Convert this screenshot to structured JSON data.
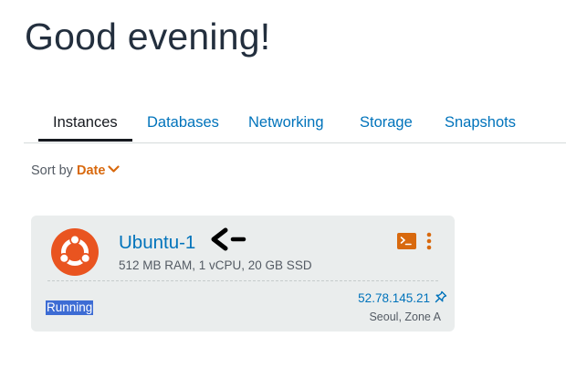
{
  "header": {
    "greeting": "Good evening!"
  },
  "tabs": [
    {
      "label": "Instances",
      "active": true
    },
    {
      "label": "Databases",
      "active": false
    },
    {
      "label": "Networking",
      "active": false
    },
    {
      "label": "Storage",
      "active": false
    },
    {
      "label": "Snapshots",
      "active": false
    }
  ],
  "sort": {
    "label": "Sort by",
    "value": "Date",
    "icon": "chevron-down-icon"
  },
  "instance": {
    "name": "Ubuntu-1",
    "specs": "512 MB RAM, 1 vCPU, 20 GB SSD",
    "status": "Running",
    "ip": "52.78.145.21",
    "location": "Seoul, Zone A",
    "logo_icon": "ubuntu-logo-icon",
    "connect_icon": "terminal-icon",
    "menu_icon": "kebab-menu-icon",
    "pin_icon": "pin-icon"
  },
  "colors": {
    "link": "#0073bb",
    "accent": "#d8690e",
    "ubuntu": "#e95420",
    "card_background": "#eaeded",
    "status_highlight": "#3d6cd4"
  }
}
